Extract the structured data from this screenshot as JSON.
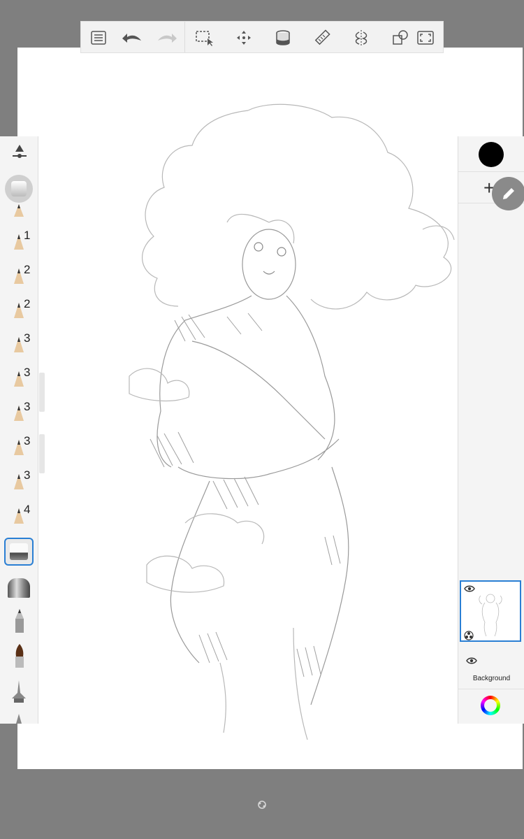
{
  "app": {
    "canvas_color": "#ffffff",
    "background_color": "#7f7f7f",
    "accent_color": "#2a7fd4"
  },
  "toolbar": {
    "items": [
      {
        "name": "list-icon"
      },
      {
        "name": "undo-icon"
      },
      {
        "name": "redo-icon"
      },
      {
        "name": "selection-icon"
      },
      {
        "name": "transform-icon"
      },
      {
        "name": "fill-bucket-icon"
      },
      {
        "name": "ruler-icon"
      },
      {
        "name": "symmetry-icon"
      },
      {
        "name": "shapes-icon"
      },
      {
        "name": "fullscreen-icon"
      }
    ]
  },
  "brushes": {
    "sizes": [
      "1",
      "2",
      "2",
      "3",
      "3",
      "3",
      "3",
      "3",
      "4"
    ],
    "selected": "eraser"
  },
  "color_panel": {
    "current_color": "#000000",
    "add_label": "+"
  },
  "layers": {
    "background_label": "Background"
  }
}
